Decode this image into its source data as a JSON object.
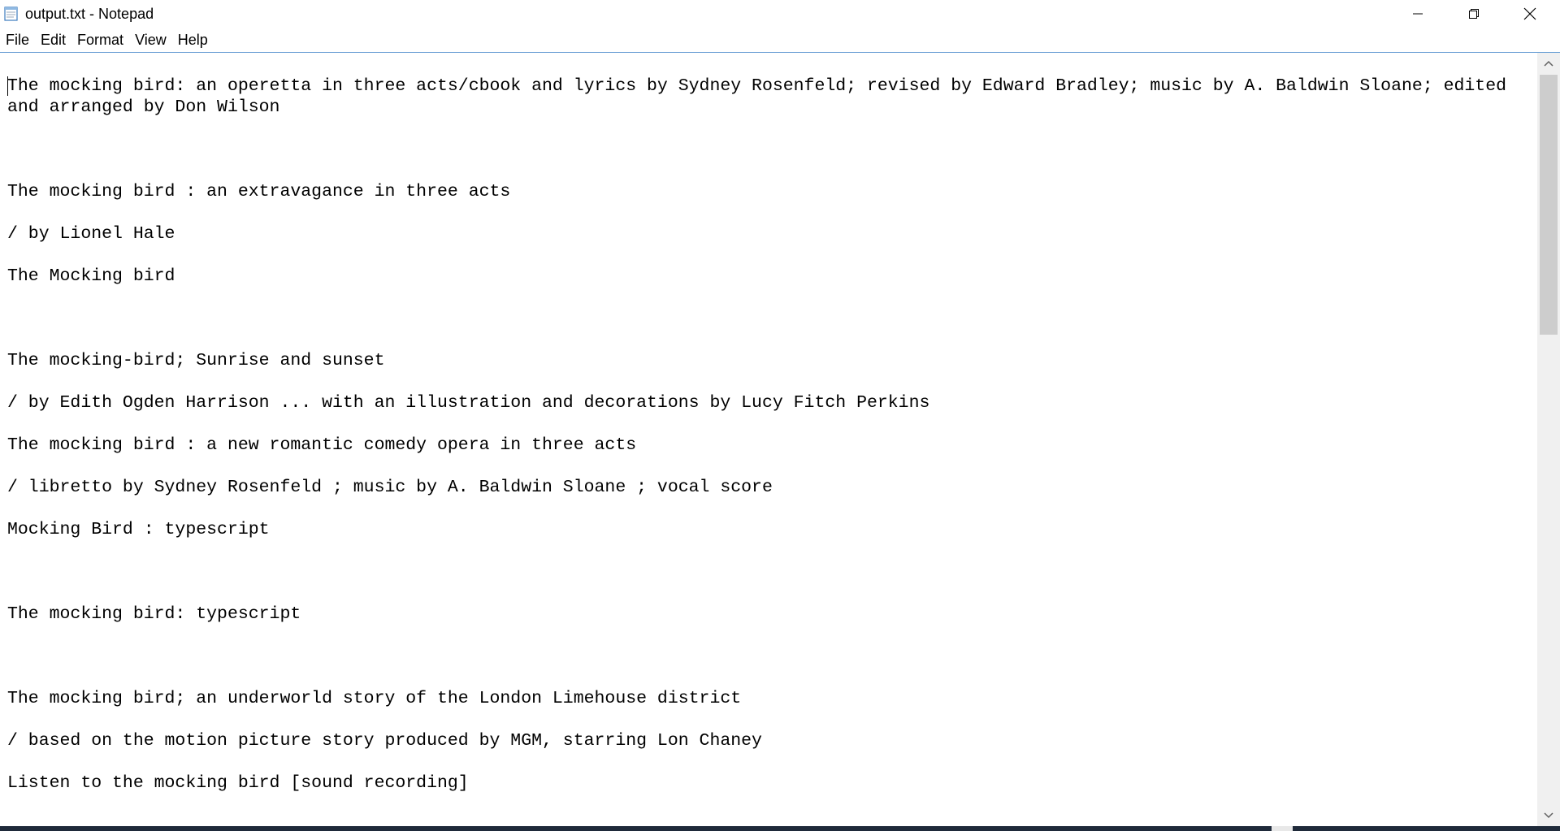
{
  "window": {
    "title": "output.txt - Notepad",
    "icon": "notepad-icon"
  },
  "controls": {
    "minimize_icon": "minimize-icon",
    "restore_icon": "restore-icon",
    "close_icon": "close-icon"
  },
  "menu": {
    "items": [
      "File",
      "Edit",
      "Format",
      "View",
      "Help"
    ]
  },
  "document": {
    "lines": [
      "The mocking bird: an operetta in three acts/cbook and lyrics by Sydney Rosenfeld; revised by Edward Bradley; music by A. Baldwin Sloane; edited and arranged by Don Wilson",
      "",
      "",
      "",
      "The mocking bird : an extravagance in three acts",
      "",
      "/ by Lionel Hale",
      "",
      "The Mocking bird",
      "",
      "",
      "",
      "The mocking-bird; Sunrise and sunset",
      "",
      "/ by Edith Ogden Harrison ... with an illustration and decorations by Lucy Fitch Perkins",
      "",
      "The mocking bird : a new romantic comedy opera in three acts",
      "",
      "/ libretto by Sydney Rosenfeld ; music by A. Baldwin Sloane ; vocal score",
      "",
      "Mocking Bird : typescript",
      "",
      "",
      "",
      "The mocking bird: typescript",
      "",
      "",
      "",
      "The mocking bird; an underworld story of the London Limehouse district",
      "",
      "/ based on the motion picture story produced by MGM, starring Lon Chaney",
      "",
      "Listen to the mocking bird [sound recording]"
    ]
  },
  "scrollbar": {
    "up_icon": "scroll-up-arrow-icon",
    "down_icon": "scroll-down-arrow-icon"
  }
}
